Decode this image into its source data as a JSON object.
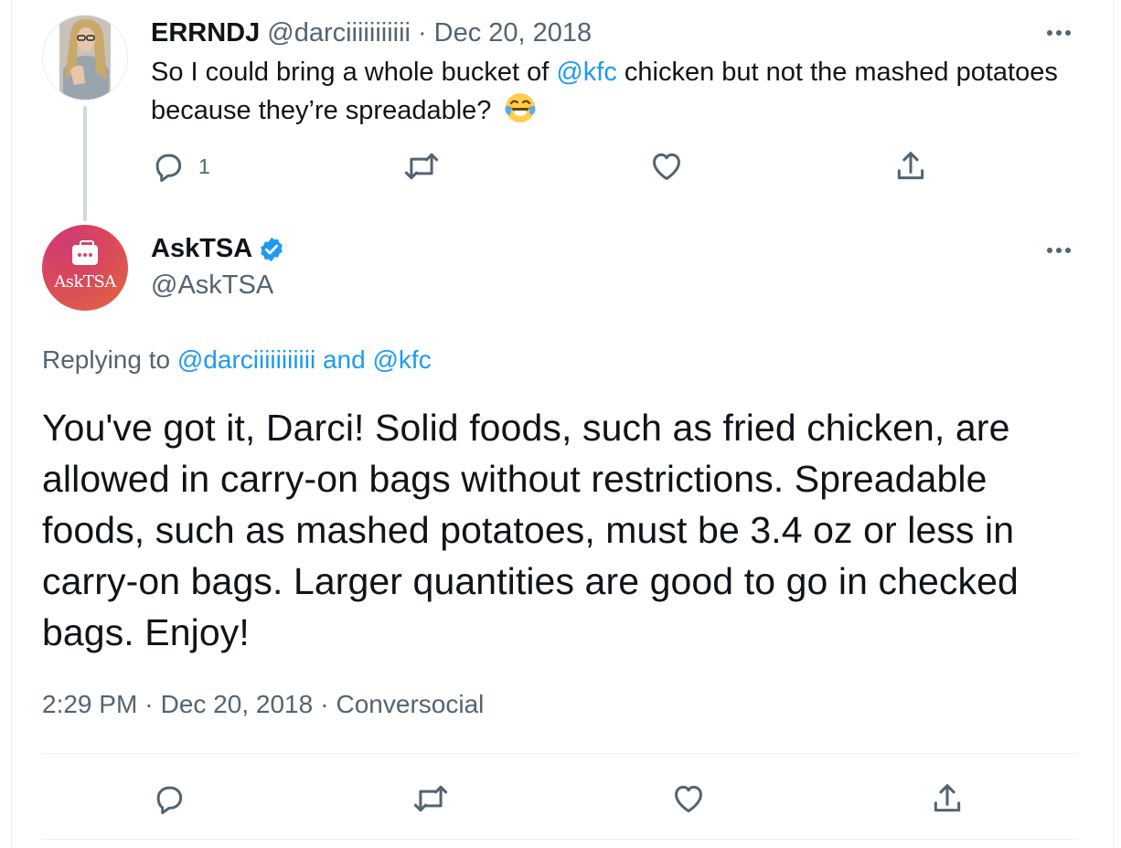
{
  "parent_tweet": {
    "author_name": "ERRNDJ",
    "author_handle": "@darciiiiiiiiiii",
    "separator": "·",
    "date": "Dec 20, 2018",
    "text_before": "So I could bring a whole bucket of ",
    "mention": "@kfc",
    "text_after": " chicken but not the mashed potatoes because they’re spreadable? ",
    "emoji": "face-with-tears-of-joy",
    "reply_count": "1"
  },
  "main_tweet": {
    "author_name": "AskTSA",
    "author_handle": "@AskTSA",
    "avatar_text": "AskTSA",
    "replying_prefix": "Replying to ",
    "replying_mention_1": "@darciiiiiiiiiii",
    "replying_and": " and ",
    "replying_mention_2": "@kfc",
    "text": "You've got it, Darci! Solid foods, such as fried chicken, are allowed in carry-on bags without restrictions. Spreadable foods, such as mashed potatoes, must be 3.4 oz or less in carry-on bags. Larger quantities are good to go in checked bags. Enjoy!",
    "time": "2:29 PM",
    "separator": "·",
    "date": "Dec 20, 2018",
    "source": "Conversocial"
  },
  "icons": {
    "reply": "reply-icon",
    "retweet": "retweet-icon",
    "like": "heart-icon",
    "share": "share-icon",
    "more": "more-icon",
    "verified": "verified-badge-icon"
  },
  "colors": {
    "text": "#0f1419",
    "secondary": "#536471",
    "link": "#1d9bf0",
    "divider": "#eff3f4",
    "avatar_gradient_start": "#cf3c74",
    "avatar_gradient_end": "#e4683e"
  }
}
